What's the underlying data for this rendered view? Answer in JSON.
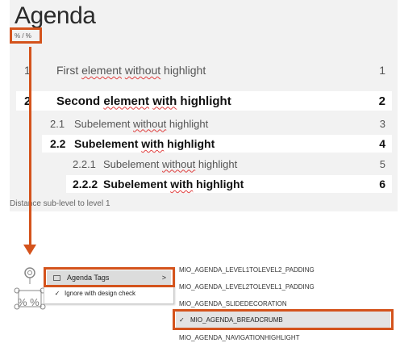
{
  "slide": {
    "title": "Agenda",
    "breadcrumb_text": "% / %",
    "items": [
      {
        "num": "1",
        "pre": "First ",
        "w1": "element",
        "mid": " ",
        "w2": "without",
        "post": " highlight",
        "page": "1"
      },
      {
        "num": "2",
        "pre": "Second ",
        "w1": "element",
        "mid": " ",
        "w2": "with",
        "post": " highlight",
        "page": "2"
      },
      {
        "num": "2.1",
        "pre": "Subelement ",
        "w1": "without",
        "post": " highlight",
        "page": "3"
      },
      {
        "num": "2.2",
        "pre": "Subelement ",
        "w1": "with",
        "post": " highlight",
        "page": "4"
      },
      {
        "num": "2.2.1",
        "pre": "Subelement ",
        "w1": "without",
        "post": " highlight",
        "page": "5"
      },
      {
        "num": "2.2.2",
        "pre": "Subelement ",
        "w1": "with",
        "post": " highlight",
        "page": "6"
      }
    ],
    "distance_label": "Distance sub-level to level 1"
  },
  "context_menu": {
    "agenda_tags_label": "Agenda Tags",
    "submenu_arrow": ">",
    "ignore_label": "Ignore with design check",
    "check_mark": "✓",
    "icon_text": "% %"
  },
  "tags": {
    "items": [
      "MIO_AGENDA_LEVEL1TOLEVEL2_PADDING",
      "MIO_AGENDA_LEVEL2TOLEVEL1_PADDING",
      "MIO_AGENDA_SLIDEDECORATION",
      "MIO_AGENDA_BREADCRUMB",
      "MIO_AGENDA_NAVIGATIONHIGHLIGHT"
    ],
    "selected_check": "✓"
  },
  "colors": {
    "highlight_box": "#d4531c",
    "slide_bg": "#f2f2f2",
    "menu_hover": "#dcdcdc"
  }
}
